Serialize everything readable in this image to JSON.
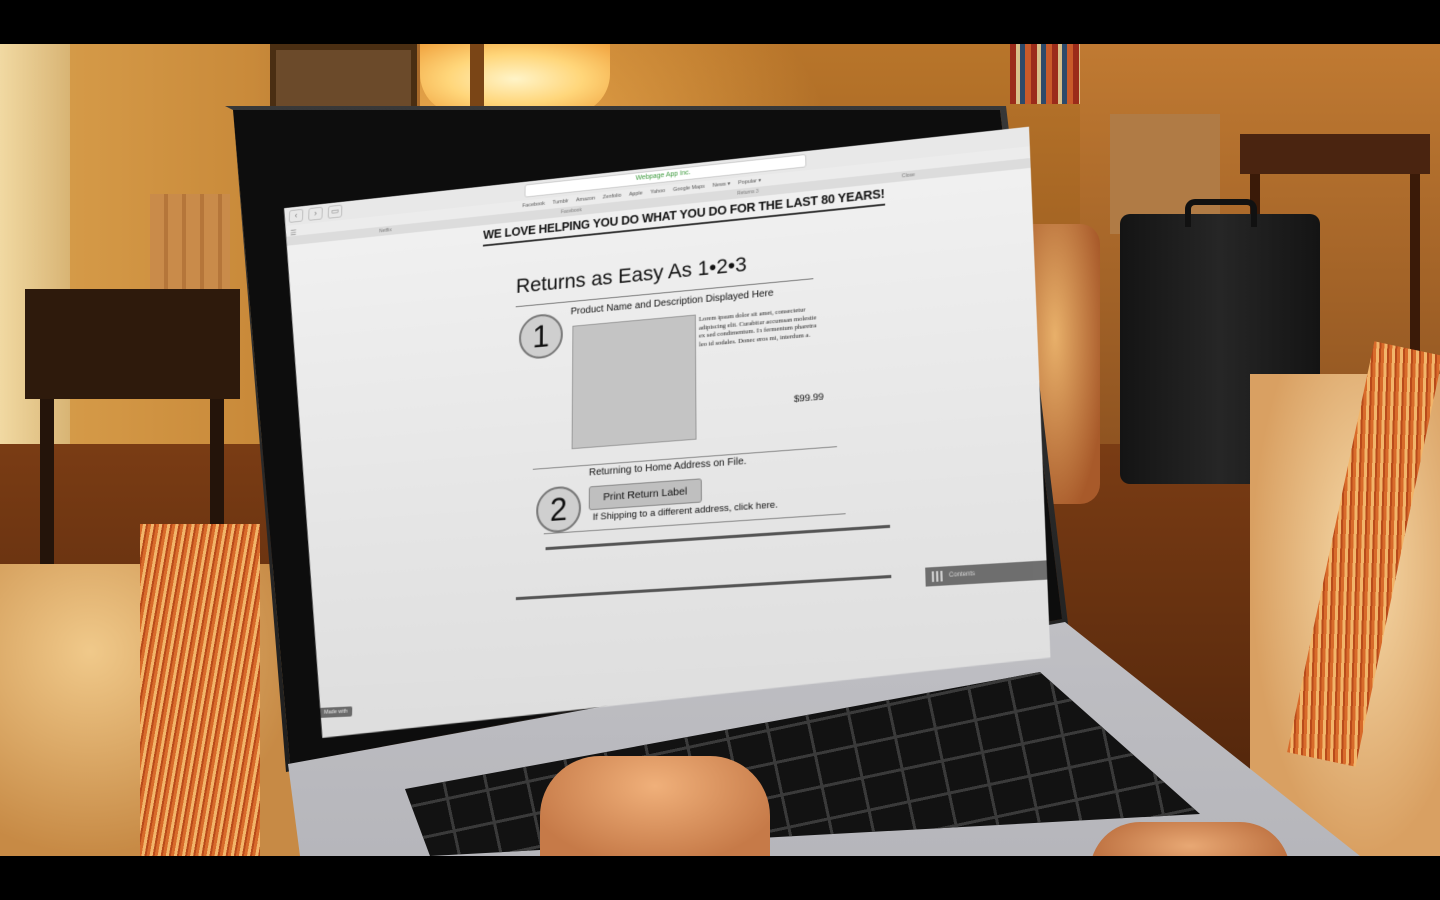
{
  "browser": {
    "url": "Webpage App Inc.",
    "bookmarks": [
      "Facebook",
      "Tumblr",
      "Amazon",
      "Zenfolio",
      "Apple",
      "Yahoo",
      "Google Maps",
      "News ▾",
      "Popular ▾"
    ],
    "tabs": [
      "Netflix",
      "Facebook",
      "Returns 3",
      "Close"
    ]
  },
  "page": {
    "headline": "WE LOVE HELPING YOU DO WHAT YOU DO FOR THE LAST 80 YEARS!",
    "title": "Returns as Easy As 1•2•3",
    "step1": {
      "number": "1",
      "product_name": "Product Name and Description Displayed Here",
      "description": "Lorem ipsum dolor sit amet, consectetur adipiscing elit. Curabitur accumsan molestie ex sed condimentum. In fermentum pharetra leo id sodales. Donec eros mi, interdum a.",
      "price": "$99.99"
    },
    "step2": {
      "number": "2",
      "returning_text": "Returning to Home Address on File.",
      "print_button": "Print Return Label",
      "shipping_link": "If Shipping to a different address, click here."
    },
    "dock_label": "Contents",
    "made_with": "Made with"
  }
}
